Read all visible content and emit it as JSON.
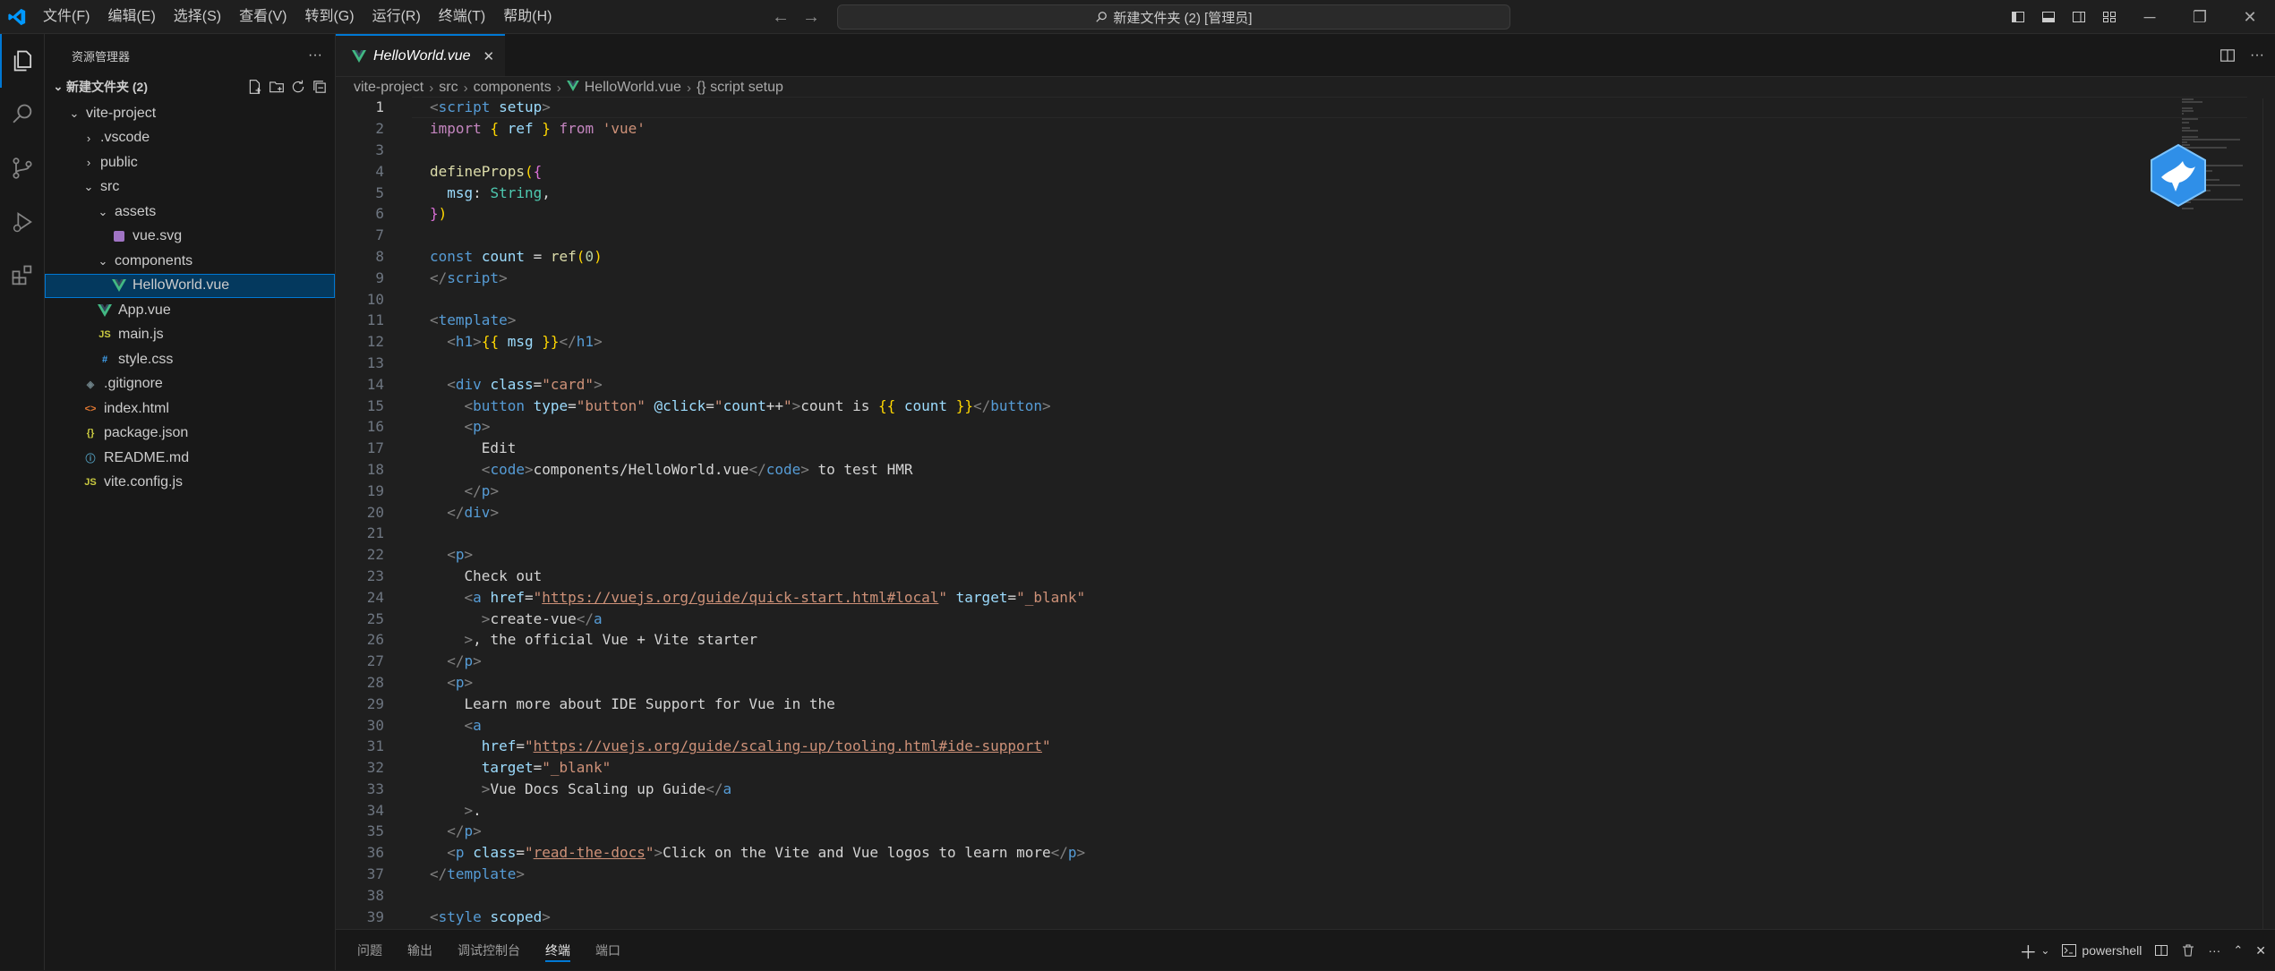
{
  "titlebar": {
    "menu": [
      "文件(F)",
      "编辑(E)",
      "选择(S)",
      "查看(V)",
      "转到(G)",
      "运行(R)",
      "终端(T)",
      "帮助(H)"
    ],
    "command_center": "新建文件夹 (2) [管理员]"
  },
  "sidebar": {
    "title": "资源管理器",
    "more": "···",
    "folder": "新建文件夹 (2)",
    "tree": [
      {
        "label": "vite-project",
        "depth": 0,
        "kind": "folder-open",
        "icon_text": ""
      },
      {
        "label": ".vscode",
        "depth": 1,
        "kind": "folder",
        "icon_text": ""
      },
      {
        "label": "public",
        "depth": 1,
        "kind": "folder",
        "icon_text": ""
      },
      {
        "label": "src",
        "depth": 1,
        "kind": "folder-open",
        "icon_text": ""
      },
      {
        "label": "assets",
        "depth": 2,
        "kind": "folder-open",
        "icon_text": ""
      },
      {
        "label": "vue.svg",
        "depth": 3,
        "kind": "svg",
        "icon_text": ""
      },
      {
        "label": "components",
        "depth": 2,
        "kind": "folder-open",
        "icon_text": ""
      },
      {
        "label": "HelloWorld.vue",
        "depth": 3,
        "kind": "vue",
        "icon_text": "",
        "selected": true
      },
      {
        "label": "App.vue",
        "depth": 2,
        "kind": "vue",
        "icon_text": ""
      },
      {
        "label": "main.js",
        "depth": 2,
        "kind": "js",
        "icon_text": "JS"
      },
      {
        "label": "style.css",
        "depth": 2,
        "kind": "css",
        "icon_text": "#"
      },
      {
        "label": ".gitignore",
        "depth": 1,
        "kind": "git",
        "icon_text": "◈"
      },
      {
        "label": "index.html",
        "depth": 1,
        "kind": "html",
        "icon_text": "<>"
      },
      {
        "label": "package.json",
        "depth": 1,
        "kind": "json",
        "icon_text": "{}"
      },
      {
        "label": "README.md",
        "depth": 1,
        "kind": "info",
        "icon_text": "ⓘ"
      },
      {
        "label": "vite.config.js",
        "depth": 1,
        "kind": "js",
        "icon_text": "JS"
      }
    ]
  },
  "editor": {
    "tab_label": "HelloWorld.vue",
    "breadcrumbs": [
      "vite-project",
      "src",
      "components",
      "HelloWorld.vue",
      "{} script setup"
    ],
    "current_line": 1,
    "lines": [
      [
        [
          "t-tag",
          "<"
        ],
        [
          "t-tn",
          "script"
        ],
        [
          "t-text",
          " "
        ],
        [
          "t-attr",
          "setup"
        ],
        [
          "t-tag",
          ">"
        ]
      ],
      [
        [
          "t-kw",
          "import"
        ],
        [
          "t-text",
          " "
        ],
        [
          "t-br",
          "{"
        ],
        [
          "t-text",
          " "
        ],
        [
          "t-var",
          "ref"
        ],
        [
          "t-text",
          " "
        ],
        [
          "t-br",
          "}"
        ],
        [
          "t-text",
          " "
        ],
        [
          "t-kw",
          "from"
        ],
        [
          "t-text",
          " "
        ],
        [
          "t-str",
          "'vue'"
        ]
      ],
      [],
      [
        [
          "t-fn",
          "defineProps"
        ],
        [
          "t-br",
          "("
        ],
        [
          "t-br2",
          "{"
        ]
      ],
      [
        [
          "t-text",
          "  "
        ],
        [
          "t-var",
          "msg"
        ],
        [
          "t-text",
          ": "
        ],
        [
          "t-type",
          "String"
        ],
        [
          "t-text",
          ","
        ]
      ],
      [
        [
          "t-br2",
          "}"
        ],
        [
          "t-br",
          ")"
        ]
      ],
      [],
      [
        [
          "t-const",
          "const"
        ],
        [
          "t-text",
          " "
        ],
        [
          "t-var",
          "count"
        ],
        [
          "t-text",
          " = "
        ],
        [
          "t-fn",
          "ref"
        ],
        [
          "t-br",
          "("
        ],
        [
          "t-num",
          "0"
        ],
        [
          "t-br",
          ")"
        ]
      ],
      [
        [
          "t-tag",
          "</"
        ],
        [
          "t-tn",
          "script"
        ],
        [
          "t-tag",
          ">"
        ]
      ],
      [],
      [
        [
          "t-tag",
          "<"
        ],
        [
          "t-tn",
          "template"
        ],
        [
          "t-tag",
          ">"
        ]
      ],
      [
        [
          "t-text",
          "  "
        ],
        [
          "t-tag",
          "<"
        ],
        [
          "t-tn",
          "h1"
        ],
        [
          "t-tag",
          ">"
        ],
        [
          "t-br",
          "{{"
        ],
        [
          "t-text",
          " "
        ],
        [
          "t-var",
          "msg"
        ],
        [
          "t-text",
          " "
        ],
        [
          "t-br",
          "}}"
        ],
        [
          "t-tag",
          "</"
        ],
        [
          "t-tn",
          "h1"
        ],
        [
          "t-tag",
          ">"
        ]
      ],
      [],
      [
        [
          "t-text",
          "  "
        ],
        [
          "t-tag",
          "<"
        ],
        [
          "t-tn",
          "div"
        ],
        [
          "t-text",
          " "
        ],
        [
          "t-attr",
          "class"
        ],
        [
          "t-text",
          "="
        ],
        [
          "t-str",
          "\"card\""
        ],
        [
          "t-tag",
          ">"
        ]
      ],
      [
        [
          "t-text",
          "    "
        ],
        [
          "t-tag",
          "<"
        ],
        [
          "t-tn",
          "button"
        ],
        [
          "t-text",
          " "
        ],
        [
          "t-attr",
          "type"
        ],
        [
          "t-text",
          "="
        ],
        [
          "t-str",
          "\"button\""
        ],
        [
          "t-text",
          " "
        ],
        [
          "t-attr",
          "@click"
        ],
        [
          "t-text",
          "="
        ],
        [
          "t-str",
          "\""
        ],
        [
          "t-var",
          "count"
        ],
        [
          "t-text",
          "++"
        ],
        [
          "t-str",
          "\""
        ],
        [
          "t-tag",
          ">"
        ],
        [
          "t-text",
          "count is "
        ],
        [
          "t-br",
          "{{"
        ],
        [
          "t-text",
          " "
        ],
        [
          "t-var",
          "count"
        ],
        [
          "t-text",
          " "
        ],
        [
          "t-br",
          "}}"
        ],
        [
          "t-tag",
          "</"
        ],
        [
          "t-tn",
          "button"
        ],
        [
          "t-tag",
          ">"
        ]
      ],
      [
        [
          "t-text",
          "    "
        ],
        [
          "t-tag",
          "<"
        ],
        [
          "t-tn",
          "p"
        ],
        [
          "t-tag",
          ">"
        ]
      ],
      [
        [
          "t-text",
          "      Edit"
        ]
      ],
      [
        [
          "t-text",
          "      "
        ],
        [
          "t-tag",
          "<"
        ],
        [
          "t-tn",
          "code"
        ],
        [
          "t-tag",
          ">"
        ],
        [
          "t-text",
          "components/HelloWorld.vue"
        ],
        [
          "t-tag",
          "</"
        ],
        [
          "t-tn",
          "code"
        ],
        [
          "t-tag",
          ">"
        ],
        [
          "t-text",
          " to test HMR"
        ]
      ],
      [
        [
          "t-text",
          "    "
        ],
        [
          "t-tag",
          "</"
        ],
        [
          "t-tn",
          "p"
        ],
        [
          "t-tag",
          ">"
        ]
      ],
      [
        [
          "t-text",
          "  "
        ],
        [
          "t-tag",
          "</"
        ],
        [
          "t-tn",
          "div"
        ],
        [
          "t-tag",
          ">"
        ]
      ],
      [],
      [
        [
          "t-text",
          "  "
        ],
        [
          "t-tag",
          "<"
        ],
        [
          "t-tn",
          "p"
        ],
        [
          "t-tag",
          ">"
        ]
      ],
      [
        [
          "t-text",
          "    Check out"
        ]
      ],
      [
        [
          "t-text",
          "    "
        ],
        [
          "t-tag",
          "<"
        ],
        [
          "t-tn",
          "a"
        ],
        [
          "t-text",
          " "
        ],
        [
          "t-attr",
          "href"
        ],
        [
          "t-text",
          "="
        ],
        [
          "t-str",
          "\""
        ],
        [
          "t-link",
          "https://vuejs.org/guide/quick-start.html#local"
        ],
        [
          "t-str",
          "\""
        ],
        [
          "t-text",
          " "
        ],
        [
          "t-attr",
          "target"
        ],
        [
          "t-text",
          "="
        ],
        [
          "t-str",
          "\"_blank\""
        ]
      ],
      [
        [
          "t-text",
          "      "
        ],
        [
          "t-tag",
          ">"
        ],
        [
          "t-text",
          "create-vue"
        ],
        [
          "t-tag",
          "</"
        ],
        [
          "t-tn",
          "a"
        ]
      ],
      [
        [
          "t-text",
          "    "
        ],
        [
          "t-tag",
          ">"
        ],
        [
          "t-text",
          ", the official Vue + Vite starter"
        ]
      ],
      [
        [
          "t-text",
          "  "
        ],
        [
          "t-tag",
          "</"
        ],
        [
          "t-tn",
          "p"
        ],
        [
          "t-tag",
          ">"
        ]
      ],
      [
        [
          "t-text",
          "  "
        ],
        [
          "t-tag",
          "<"
        ],
        [
          "t-tn",
          "p"
        ],
        [
          "t-tag",
          ">"
        ]
      ],
      [
        [
          "t-text",
          "    Learn more about IDE Support for Vue in the"
        ]
      ],
      [
        [
          "t-text",
          "    "
        ],
        [
          "t-tag",
          "<"
        ],
        [
          "t-tn",
          "a"
        ]
      ],
      [
        [
          "t-text",
          "      "
        ],
        [
          "t-attr",
          "href"
        ],
        [
          "t-text",
          "="
        ],
        [
          "t-str",
          "\""
        ],
        [
          "t-link",
          "https://vuejs.org/guide/scaling-up/tooling.html#ide-support"
        ],
        [
          "t-str",
          "\""
        ]
      ],
      [
        [
          "t-text",
          "      "
        ],
        [
          "t-attr",
          "target"
        ],
        [
          "t-text",
          "="
        ],
        [
          "t-str",
          "\"_blank\""
        ]
      ],
      [
        [
          "t-text",
          "      "
        ],
        [
          "t-tag",
          ">"
        ],
        [
          "t-text",
          "Vue Docs Scaling up Guide"
        ],
        [
          "t-tag",
          "</"
        ],
        [
          "t-tn",
          "a"
        ]
      ],
      [
        [
          "t-text",
          "    "
        ],
        [
          "t-tag",
          ">"
        ],
        [
          "t-text",
          "."
        ]
      ],
      [
        [
          "t-text",
          "  "
        ],
        [
          "t-tag",
          "</"
        ],
        [
          "t-tn",
          "p"
        ],
        [
          "t-tag",
          ">"
        ]
      ],
      [
        [
          "t-text",
          "  "
        ],
        [
          "t-tag",
          "<"
        ],
        [
          "t-tn",
          "p"
        ],
        [
          "t-text",
          " "
        ],
        [
          "t-attr",
          "class"
        ],
        [
          "t-text",
          "="
        ],
        [
          "t-str",
          "\""
        ],
        [
          "t-link",
          "read-the-docs"
        ],
        [
          "t-str",
          "\""
        ],
        [
          "t-tag",
          ">"
        ],
        [
          "t-text",
          "Click on the Vite and Vue logos to learn more"
        ],
        [
          "t-tag",
          "</"
        ],
        [
          "t-tn",
          "p"
        ],
        [
          "t-tag",
          ">"
        ]
      ],
      [
        [
          "t-tag",
          "</"
        ],
        [
          "t-tn",
          "template"
        ],
        [
          "t-tag",
          ">"
        ]
      ],
      [],
      [
        [
          "t-tag",
          "<"
        ],
        [
          "t-tn",
          "style"
        ],
        [
          "t-text",
          " "
        ],
        [
          "t-attr",
          "scoped"
        ],
        [
          "t-tag",
          ">"
        ]
      ]
    ]
  },
  "panel": {
    "tabs": [
      "问题",
      "输出",
      "调试控制台",
      "终端",
      "端口"
    ],
    "active_tab": 3,
    "terminal_name": "powershell"
  },
  "colors": {
    "accent": "#0078d4",
    "vue_green": "#42b883",
    "js_yellow": "#cbcb41",
    "css_blue": "#42a5f5",
    "html_orange": "#e37933"
  }
}
